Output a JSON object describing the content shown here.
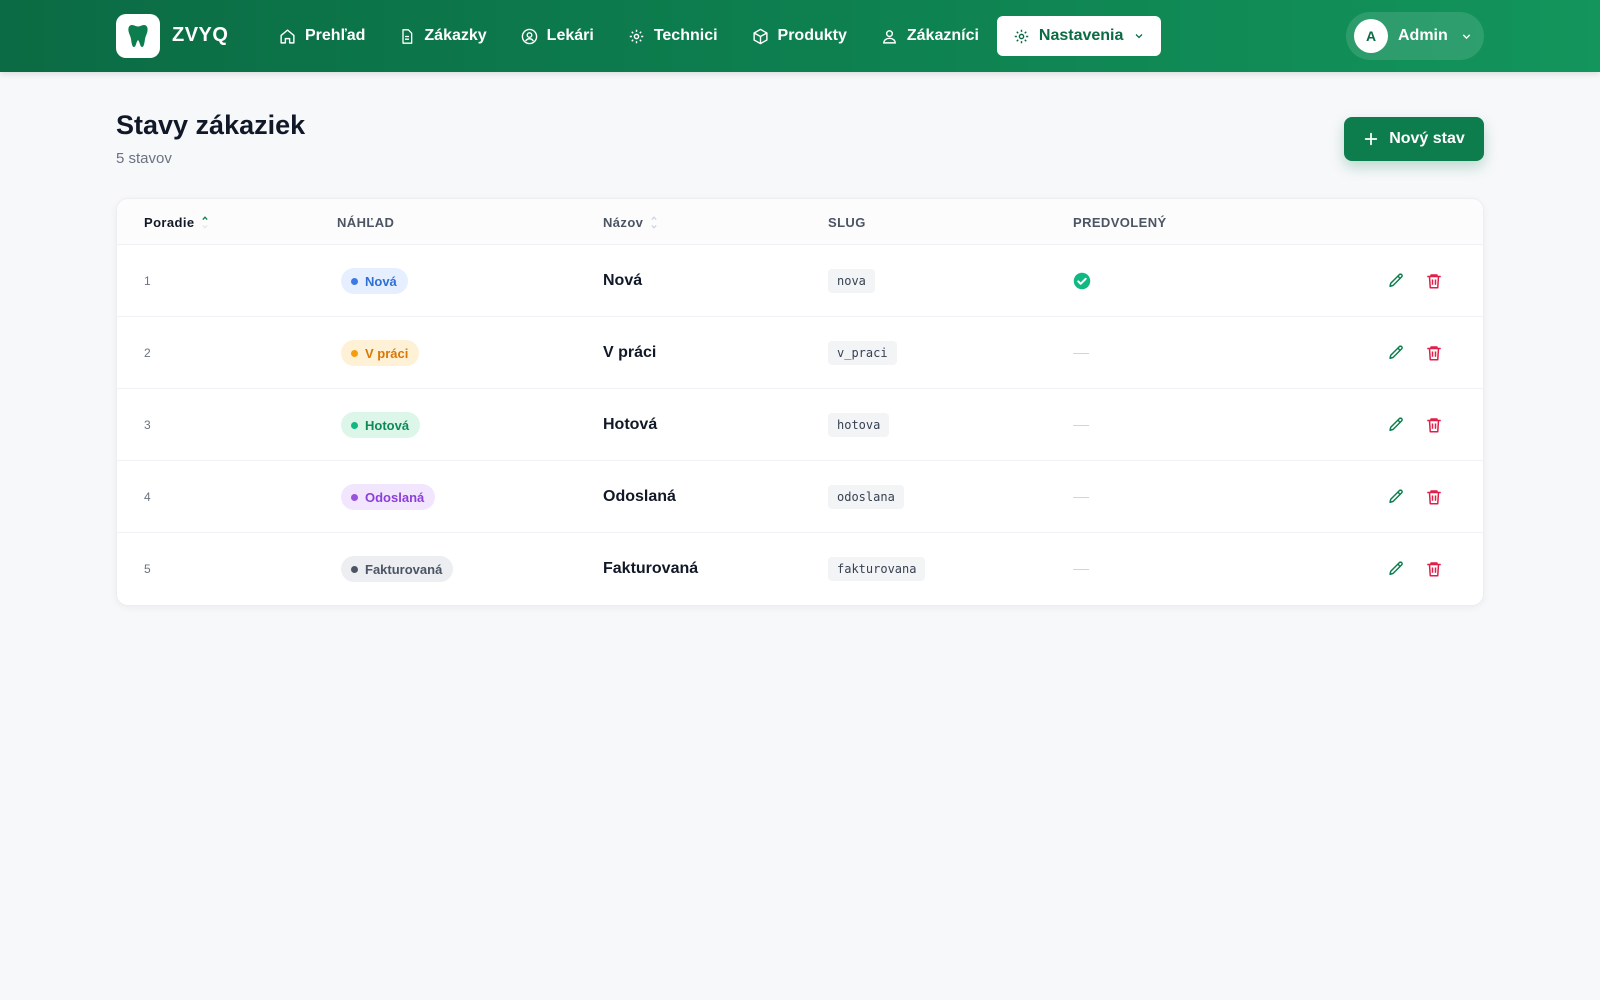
{
  "app": {
    "name": "ZVYQ",
    "colors": {
      "primary": "#0d7d4e",
      "danger": "#e11d48",
      "success": "#10b981"
    }
  },
  "nav": {
    "items": [
      {
        "label": "Prehľad",
        "icon": "home-icon"
      },
      {
        "label": "Zákazky",
        "icon": "document-icon"
      },
      {
        "label": "Lekári",
        "icon": "user-circle-icon"
      },
      {
        "label": "Technici",
        "icon": "gear-icon"
      },
      {
        "label": "Produkty",
        "icon": "box-icon"
      },
      {
        "label": "Zákazníci",
        "icon": "person-icon"
      }
    ],
    "active": {
      "label": "Nastavenia",
      "icon": "gear-icon"
    }
  },
  "user": {
    "initial": "A",
    "name": "Admin"
  },
  "page": {
    "title": "Stavy zákaziek",
    "subtitle": "5 stavov",
    "new_button": "Nový stav"
  },
  "table": {
    "headers": {
      "order": "Poradie",
      "preview": "NÁHĽAD",
      "name": "Názov",
      "slug": "SLUG",
      "default": "PREDVOLENÝ"
    },
    "rows": [
      {
        "order": "1",
        "badge": "Nová",
        "name": "Nová",
        "slug": "nova",
        "is_default": true,
        "badge_bg": "#e5efff",
        "badge_fg": "#2f6fd6",
        "dot": "#3b7ae6"
      },
      {
        "order": "2",
        "badge": "V práci",
        "name": "V práci",
        "slug": "v_praci",
        "is_default": false,
        "badge_bg": "#fff1d6",
        "badge_fg": "#d97706",
        "dot": "#f59e0b"
      },
      {
        "order": "3",
        "badge": "Hotová",
        "name": "Hotová",
        "slug": "hotova",
        "is_default": false,
        "badge_bg": "#dcf7ea",
        "badge_fg": "#0f8a57",
        "dot": "#10b981"
      },
      {
        "order": "4",
        "badge": "Odoslaná",
        "name": "Odoslaná",
        "slug": "odoslana",
        "is_default": false,
        "badge_bg": "#f1e6fd",
        "badge_fg": "#8b3fd9",
        "dot": "#9b51e0"
      },
      {
        "order": "5",
        "badge": "Fakturovaná",
        "name": "Fakturovaná",
        "slug": "fakturovana",
        "is_default": false,
        "badge_bg": "#eceef2",
        "badge_fg": "#4b5563",
        "dot": "#4b5563"
      }
    ]
  }
}
